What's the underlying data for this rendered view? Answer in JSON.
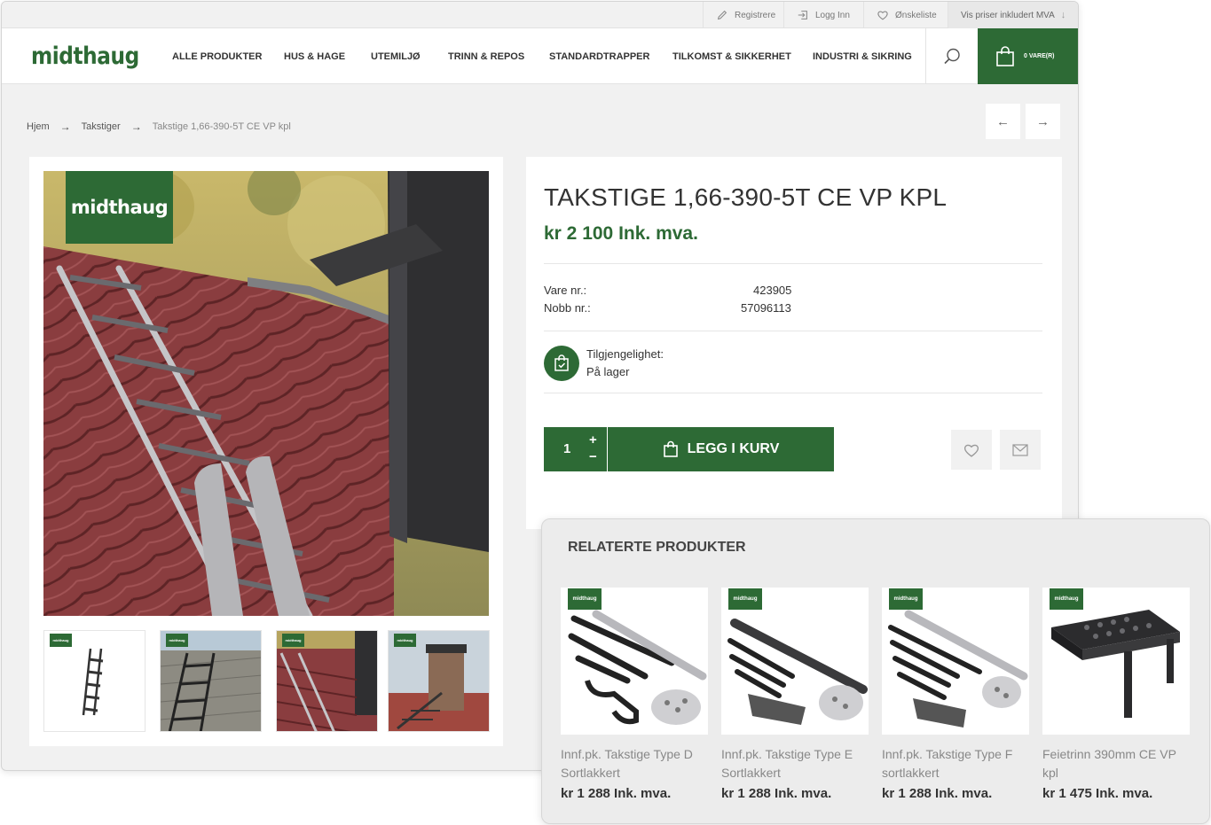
{
  "topbar": {
    "register": "Registrere",
    "login": "Logg Inn",
    "wishlist": "Ønskeliste",
    "prices_note": "Vis priser inkludert MVA"
  },
  "header": {
    "logo": "midthaug",
    "nav": [
      "ALLE PRODUKTER",
      "HUS & HAGE",
      "UTEMILJØ",
      "TRINN & REPOS",
      "STANDARDTRAPPER",
      "TILKOMST & SIKKERHET",
      "INDUSTRI & SIKRING"
    ],
    "cart_label": "0 VARE(R)"
  },
  "breadcrumb": {
    "home": "Hjem",
    "category": "Takstiger",
    "current": "Takstige 1,66-390-5T CE VP kpl"
  },
  "gallery": {
    "badge": "midthaug",
    "thumb_badge": "midthaug"
  },
  "product": {
    "title": "TAKSTIGE 1,66-390-5T CE VP KPL",
    "price": "kr 2 100 Ink. mva.",
    "sku_label": "Vare nr.:",
    "sku": "423905",
    "nobb_label": "Nobb nr.:",
    "nobb": "57096113",
    "availability_label": "Tilgjengelighet:",
    "availability": "På lager",
    "quantity": "1",
    "plus": "+",
    "minus": "−",
    "add_to_cart": "LEGG I KURV"
  },
  "related": {
    "title": "RELATERTE PRODUKTER",
    "badge": "midthaug",
    "items": [
      {
        "name": "Innf.pk. Takstige Type D Sortlakkert",
        "price": "kr 1 288 Ink. mva."
      },
      {
        "name": "Innf.pk. Takstige Type E Sortlakkert",
        "price": "kr 1 288 Ink. mva."
      },
      {
        "name": "Innf.pk. Takstige Type F sortlakkert",
        "price": "kr 1 288 Ink. mva."
      },
      {
        "name": "Feietrinn 390mm CE VP kpl",
        "price": "kr 1 475 Ink. mva."
      }
    ]
  },
  "colors": {
    "brand_green": "#2d6a35",
    "roof_red": "#8a3d3f",
    "background": "#f1f1f1"
  },
  "icons": [
    "pencil-icon",
    "login-icon",
    "heart-icon",
    "arrow-down-icon",
    "search-icon",
    "bag-icon",
    "arrow-left-icon",
    "arrow-right-icon",
    "shopping-bag-check-icon",
    "mail-icon"
  ]
}
